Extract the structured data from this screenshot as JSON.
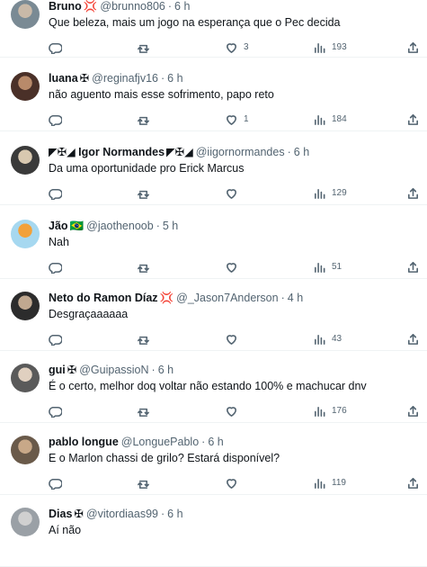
{
  "tweets": [
    {
      "name": "Bruno",
      "name_suffix": "💢",
      "handle": "@brunno806",
      "time": "6 h",
      "text": "Que beleza, mais um jogo na esperança que o Pec decida",
      "replies": "",
      "retweets": "",
      "likes": "3",
      "views": "193",
      "avatar_colors": [
        "#7a8a94",
        "#c9b9a8"
      ]
    },
    {
      "name": "luana",
      "name_suffix": "✠",
      "handle": "@reginafjv16",
      "time": "6 h",
      "text": "não aguento mais esse sofrimento, papo reto",
      "replies": "",
      "retweets": "",
      "likes": "1",
      "views": "184",
      "avatar_colors": [
        "#4a3028",
        "#b88a6a"
      ]
    },
    {
      "name": "◤✠◢ Igor Normandes",
      "name_suffix": "◤✠◢",
      "handle": "@iigornormandes",
      "time": "6 h",
      "text": "Da uma oportunidade pro Erick Marcus",
      "replies": "",
      "retweets": "",
      "likes": "",
      "views": "129",
      "avatar_colors": [
        "#3a3a3a",
        "#d8c8b0"
      ]
    },
    {
      "name": "Jão",
      "name_suffix": "🇧🇷",
      "handle": "@jaothenoob",
      "time": "5 h",
      "text": "Nah",
      "replies": "",
      "retweets": "",
      "likes": "",
      "views": "51",
      "avatar_colors": [
        "#a6d8f0",
        "#f2a13a"
      ]
    },
    {
      "name": "Neto do Ramon Díaz",
      "name_suffix": "💢",
      "handle": "@_Jason7Anderson",
      "time": "4 h",
      "text": "Desgraçaaaaaa",
      "replies": "",
      "retweets": "",
      "likes": "",
      "views": "43",
      "avatar_colors": [
        "#2c2c2c",
        "#c0a890"
      ]
    },
    {
      "name": "gui",
      "name_suffix": "✠",
      "handle": "@GuipassioN",
      "time": "6 h",
      "text": "É o certo, melhor doq voltar não estando 100% e machucar dnv",
      "replies": "",
      "retweets": "",
      "likes": "",
      "views": "176",
      "avatar_colors": [
        "#5a5a5a",
        "#e0d0c0"
      ]
    },
    {
      "name": "pablo longue",
      "name_suffix": "",
      "handle": "@LonguePablo",
      "time": "6 h",
      "text": "E o Marlon chassi de grilo? Estará disponível?",
      "replies": "",
      "retweets": "",
      "likes": "",
      "views": "119",
      "avatar_colors": [
        "#6a5a4a",
        "#c8a888"
      ]
    },
    {
      "name": "Dias",
      "name_suffix": "✠",
      "handle": "@vitordiaas99",
      "time": "6 h",
      "text": "Aí não",
      "replies": "",
      "retweets": "",
      "likes": "",
      "views": "",
      "avatar_colors": [
        "#9aa0a6",
        "#d0d0d0"
      ]
    }
  ],
  "colors": {
    "text": "#0f1419",
    "muted": "#536471",
    "divider": "#eff3f4"
  }
}
